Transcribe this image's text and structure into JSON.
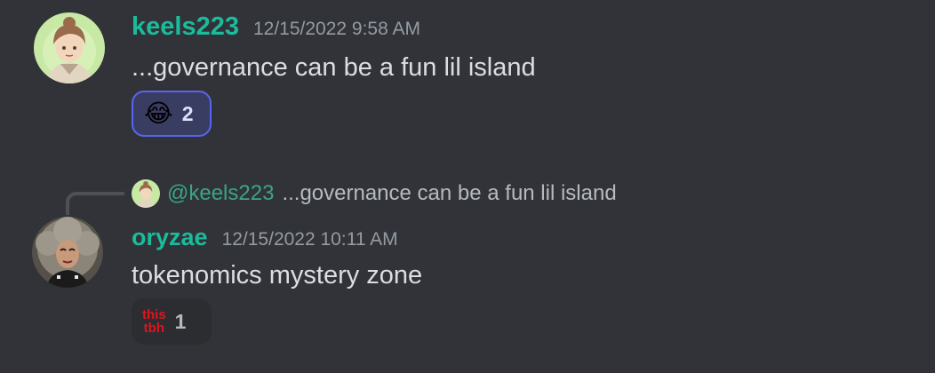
{
  "colors": {
    "background": "#313338",
    "username_teal": "#1abc9c",
    "mention_teal": "#3ba38a",
    "text": "#dbdee1",
    "muted": "#949ba4",
    "reaction_active_border": "#5865f2",
    "reaction_active_bg": "#393d61",
    "reaction_bg": "#2b2d31"
  },
  "messages": [
    {
      "username": "keels223",
      "timestamp": "12/15/2022 9:58 AM",
      "content": "...governance can be a fun lil island",
      "reaction": {
        "emoji": "😂",
        "emoji_name": "joy-emoji",
        "count": "2",
        "reacted": true
      }
    },
    {
      "reply": {
        "mention": "@keels223",
        "text": "...governance can be a fun lil island"
      },
      "username": "oryzae",
      "timestamp": "12/15/2022 10:11 AM",
      "content": "tokenomics mystery zone",
      "reaction": {
        "emoji_name": "thistbh-emoji",
        "emoji_text": [
          "this",
          "tbh"
        ],
        "count": "1",
        "reacted": false
      }
    }
  ]
}
